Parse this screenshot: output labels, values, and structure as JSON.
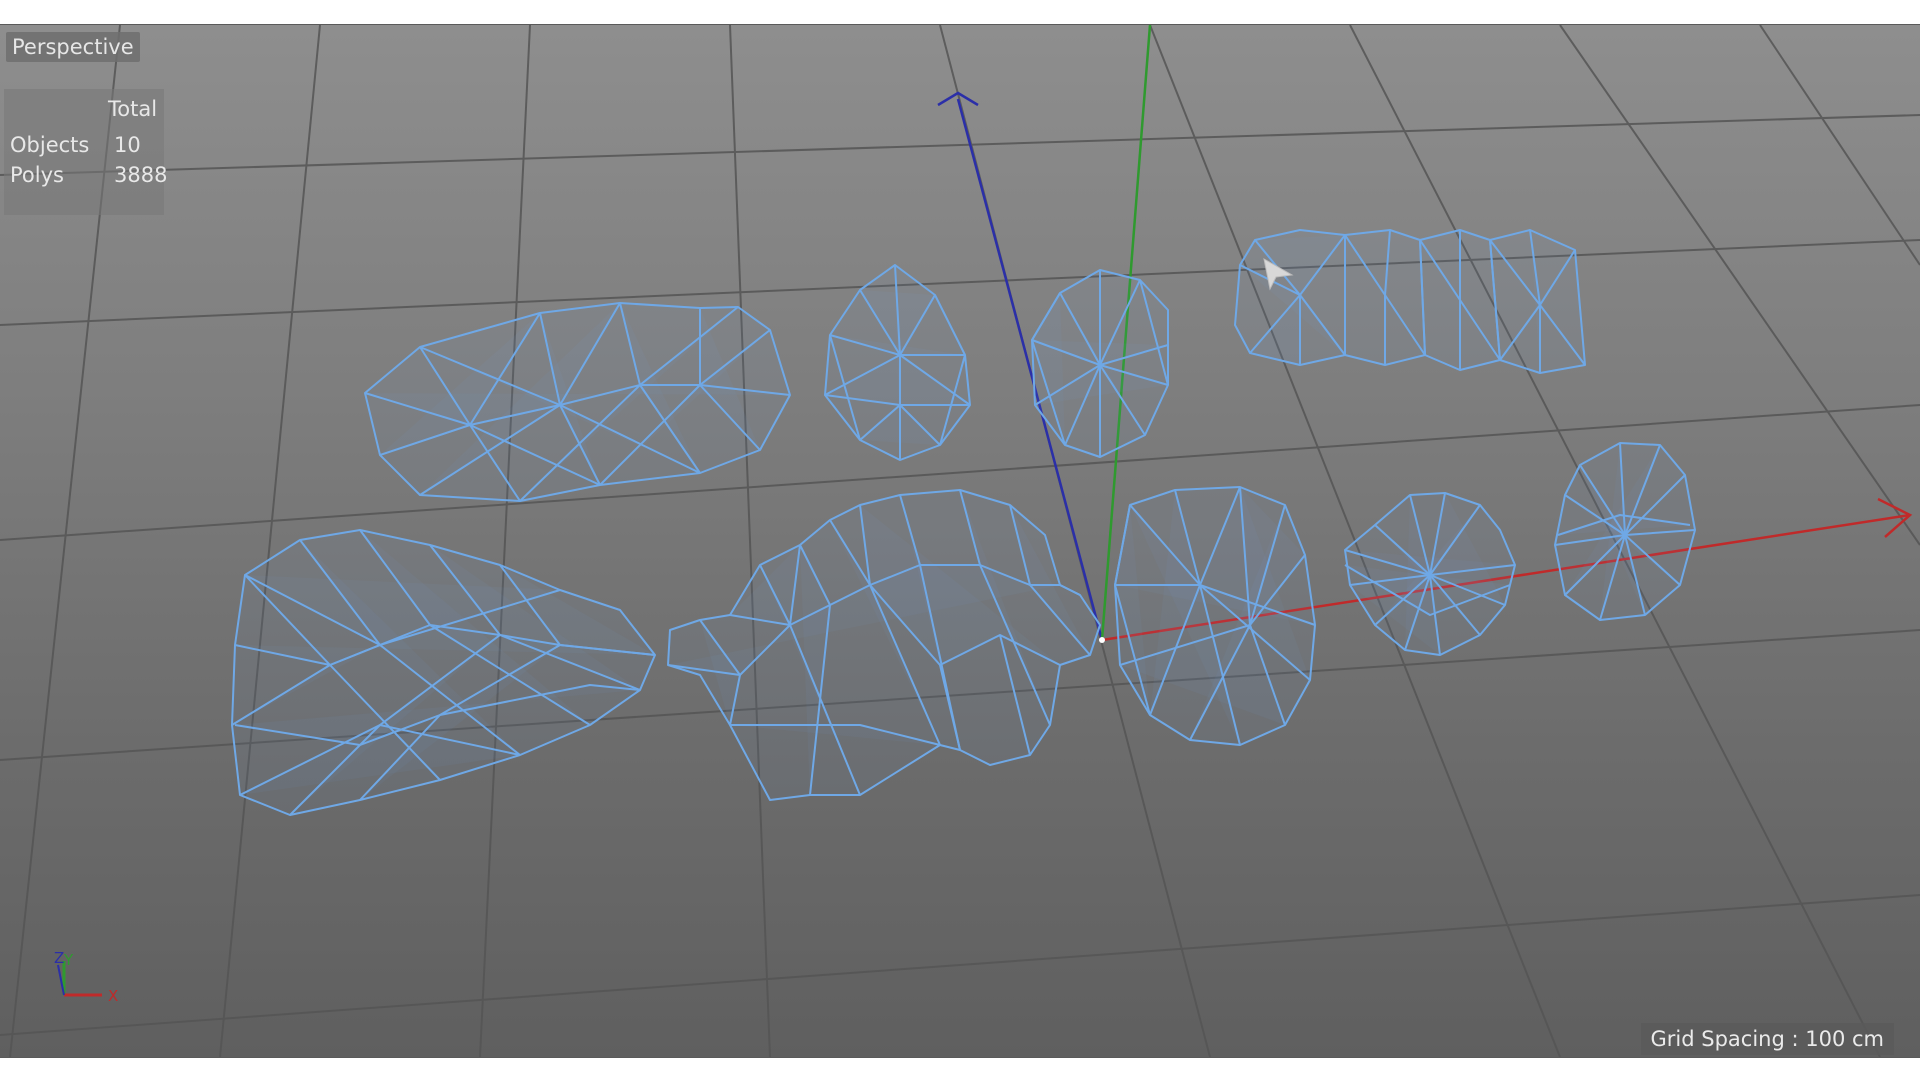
{
  "viewport": {
    "label": "Perspective",
    "grid_spacing": "Grid Spacing : 100 cm"
  },
  "stats": {
    "header": "Total",
    "rows": [
      {
        "key": "Objects",
        "value": "10"
      },
      {
        "key": "Polys",
        "value": "3888"
      }
    ]
  },
  "gizmo": {
    "axis_x": "X",
    "axis_y": "Y",
    "axis_z": "Z"
  },
  "colors": {
    "wireframe": "#6fa8e6",
    "axis_x": "#c02a2a",
    "axis_y": "#2f9a2f",
    "axis_z": "#2b2fa8",
    "grid": "#555555"
  },
  "icons": {
    "cursor": "arrow-cursor-icon",
    "gizmo": "axis-gizmo-icon"
  }
}
